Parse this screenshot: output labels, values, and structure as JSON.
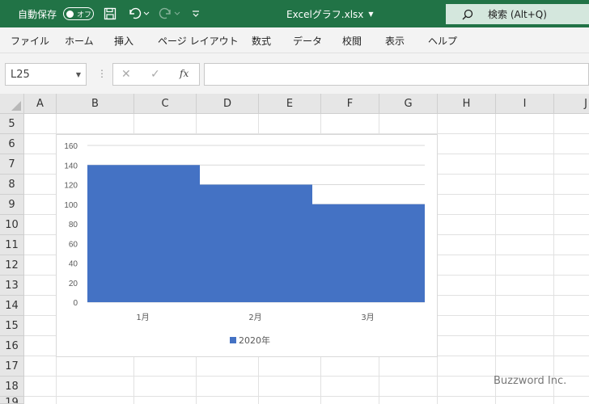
{
  "titlebar": {
    "autosave_label": "自動保存",
    "autosave_state": "オフ",
    "filename": "Excelグラフ.xlsx",
    "search_placeholder": "検索 (Alt+Q)"
  },
  "ribbon": {
    "tabs": [
      "ファイル",
      "ホーム",
      "挿入",
      "ページ レイアウト",
      "数式",
      "データ",
      "校閲",
      "表示",
      "ヘルプ"
    ]
  },
  "formula_bar": {
    "name_box": "L25",
    "fx_label": "fx",
    "formula": ""
  },
  "grid": {
    "columns": [
      "A",
      "B",
      "C",
      "D",
      "E",
      "F",
      "G",
      "H",
      "I",
      "J"
    ],
    "rows": [
      "5",
      "6",
      "7",
      "8",
      "9",
      "10",
      "11",
      "12",
      "13",
      "14",
      "15",
      "16",
      "17",
      "18",
      "19"
    ]
  },
  "chart_data": {
    "type": "bar",
    "categories": [
      "1月",
      "2月",
      "3月"
    ],
    "series": [
      {
        "name": "2020年",
        "values": [
          140,
          120,
          100
        ],
        "color": "#4472c4"
      }
    ],
    "ylim": [
      0,
      160
    ],
    "yticks": [
      "0",
      "20",
      "40",
      "60",
      "80",
      "100",
      "120",
      "140",
      "160"
    ],
    "grid": true,
    "legend": "bottom"
  },
  "watermark": "Buzzword Inc."
}
